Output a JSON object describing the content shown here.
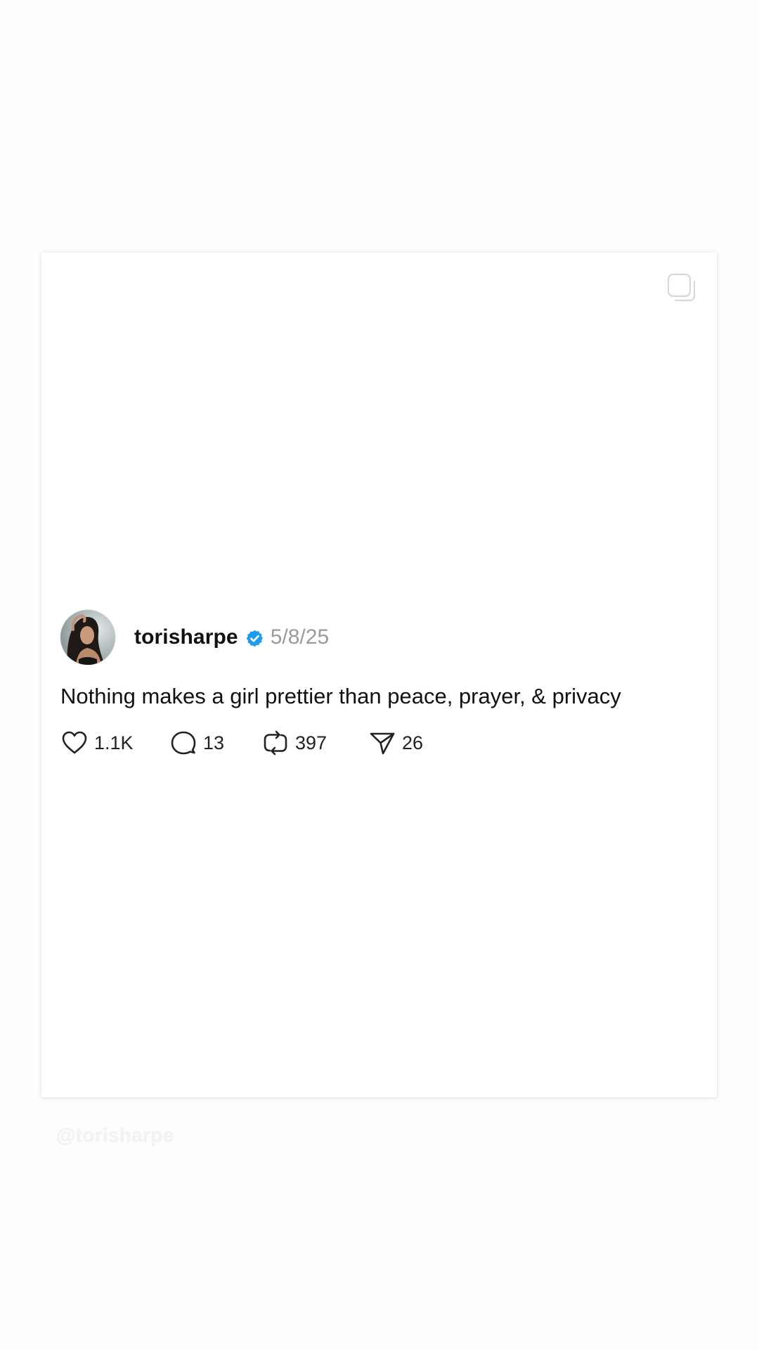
{
  "post": {
    "username": "torisharpe",
    "date": "5/8/25",
    "text": "Nothing makes a girl prettier than peace, prayer, & privacy",
    "verified": true,
    "verified_color": "#1d9bf0"
  },
  "actions": {
    "likes": "1.1K",
    "replies": "13",
    "reposts": "397",
    "shares": "26"
  },
  "icons": {
    "multi_image": "multi-image-icon",
    "like": "heart-icon",
    "reply": "speech-bubble-icon",
    "repost": "repost-icon",
    "share": "paper-plane-icon"
  },
  "watermark": "@torisharpe"
}
